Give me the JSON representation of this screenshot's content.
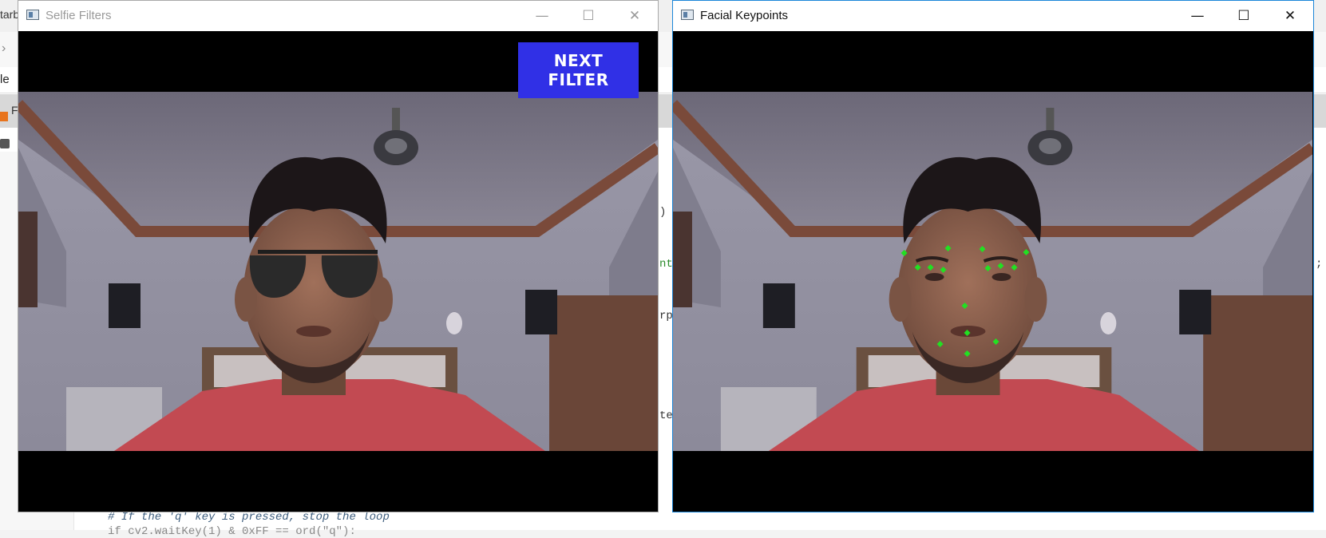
{
  "ide": {
    "tab_fragment": "tarb",
    "file_fragment": "le",
    "panel_fragment": "F",
    "code_fragments": [
      ")",
      "nt",
      "rp",
      "te"
    ],
    "right_fragment": ";",
    "comment_line": "# If the 'q' key is pressed, stop the loop",
    "next_line": "if cv2.waitKey(1) & 0xFF == ord(\"q\"):"
  },
  "windows": [
    {
      "title": "Selfie Filters",
      "active": false,
      "controls": {
        "minimize": "—",
        "maximize": "☐",
        "close": "✕"
      },
      "overlay": {
        "button_label": "NEXT FILTER",
        "button_color": "#3030e6"
      },
      "filter": "sunglasses"
    },
    {
      "title": "Facial Keypoints",
      "active": true,
      "controls": {
        "minimize": "—",
        "maximize": "☐",
        "close": "✕"
      },
      "keypoint_color": "#22e022",
      "keypoint_count": 15
    }
  ]
}
